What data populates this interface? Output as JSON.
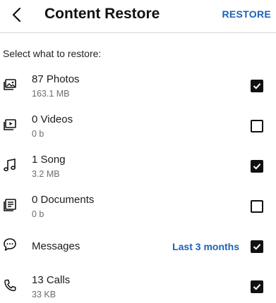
{
  "header": {
    "title": "Content Restore",
    "action_label": "RESTORE"
  },
  "subhead": "Select what to restore:",
  "items": [
    {
      "icon": "photo-icon",
      "label": "87 Photos",
      "size": "163.1 MB",
      "checked": true
    },
    {
      "icon": "video-icon",
      "label": "0 Videos",
      "size": "0 b",
      "checked": false
    },
    {
      "icon": "music-note-icon",
      "label": "1 Song",
      "size": "3.2 MB",
      "checked": true
    },
    {
      "icon": "document-icon",
      "label": "0 Documents",
      "size": "0 b",
      "checked": false
    },
    {
      "icon": "message-bubble-icon",
      "label": "Messages",
      "option": "Last 3 months",
      "checked": true
    },
    {
      "icon": "phone-icon",
      "label": "13 Calls",
      "size": "33 KB",
      "checked": true
    }
  ],
  "colors": {
    "accent": "#1a63b7",
    "text": "#111111",
    "secondary_text": "#6d6d6d"
  }
}
